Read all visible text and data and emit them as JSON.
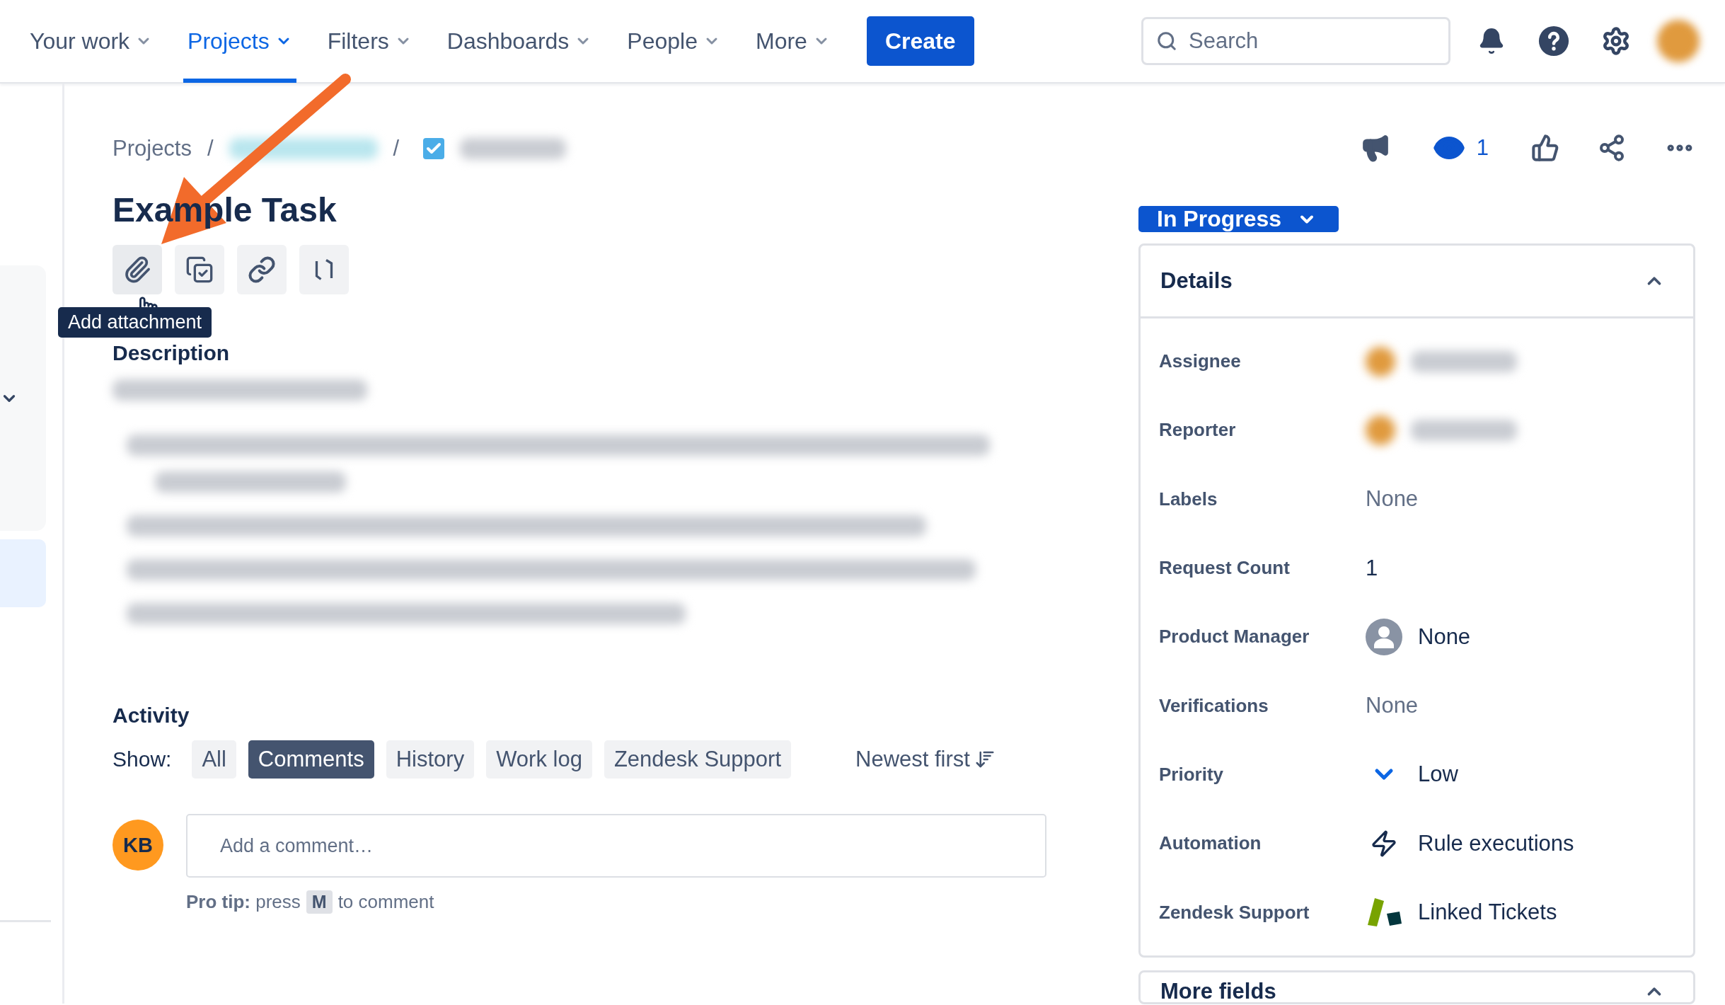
{
  "nav": {
    "items": [
      {
        "label": "Your work",
        "selected": false
      },
      {
        "label": "Projects",
        "selected": true
      },
      {
        "label": "Filters",
        "selected": false
      },
      {
        "label": "Dashboards",
        "selected": false
      },
      {
        "label": "People",
        "selected": false
      },
      {
        "label": "More",
        "selected": false
      }
    ],
    "create": "Create",
    "search": {
      "placeholder": "Search"
    }
  },
  "breadcrumb": [
    {
      "kind": "link",
      "label": "Projects"
    },
    {
      "kind": "sep",
      "label": "/"
    },
    {
      "kind": "redacted"
    },
    {
      "kind": "sep",
      "label": "/"
    },
    {
      "kind": "issue"
    }
  ],
  "issue": {
    "title": "Example Task",
    "tooltip": "Add attachment",
    "watchers": "1",
    "status": "In Progress"
  },
  "description": {
    "heading": "Description"
  },
  "activity": {
    "heading": "Activity",
    "show_label": "Show:",
    "filters": [
      {
        "label": "All",
        "selected": false
      },
      {
        "label": "Comments",
        "selected": true
      },
      {
        "label": "History",
        "selected": false
      },
      {
        "label": "Work log",
        "selected": false
      },
      {
        "label": "Zendesk Support",
        "selected": false
      }
    ],
    "sort": "Newest first",
    "avatar_initials": "KB",
    "comment_placeholder": "Add a comment…",
    "pro_tip": "**Pro tip:** press",
    "key": "M",
    "pro_tip_end": "to comment"
  },
  "details": {
    "heading": "Details",
    "expanded": true,
    "fields": [
      {
        "label": "Assignee",
        "kind": "redacted"
      },
      {
        "label": "Reporter",
        "kind": "redacted"
      },
      {
        "label": "Labels",
        "kind": "muted",
        "value": "None"
      },
      {
        "label": "Request Count",
        "kind": "text",
        "value": "1"
      },
      {
        "label": "Product Manager",
        "kind": "person",
        "value": "None"
      },
      {
        "label": "Verifications",
        "kind": "muted",
        "value": "None"
      },
      {
        "label": "Priority",
        "kind": "priority",
        "value": "Low"
      },
      {
        "label": "Automation",
        "kind": "automation",
        "value": "Rule executions"
      },
      {
        "label": "Zendesk Support",
        "kind": "zendesk",
        "value": "Linked Tickets"
      }
    ]
  },
  "more_fields": {
    "heading": "More fields",
    "expanded": true
  }
}
